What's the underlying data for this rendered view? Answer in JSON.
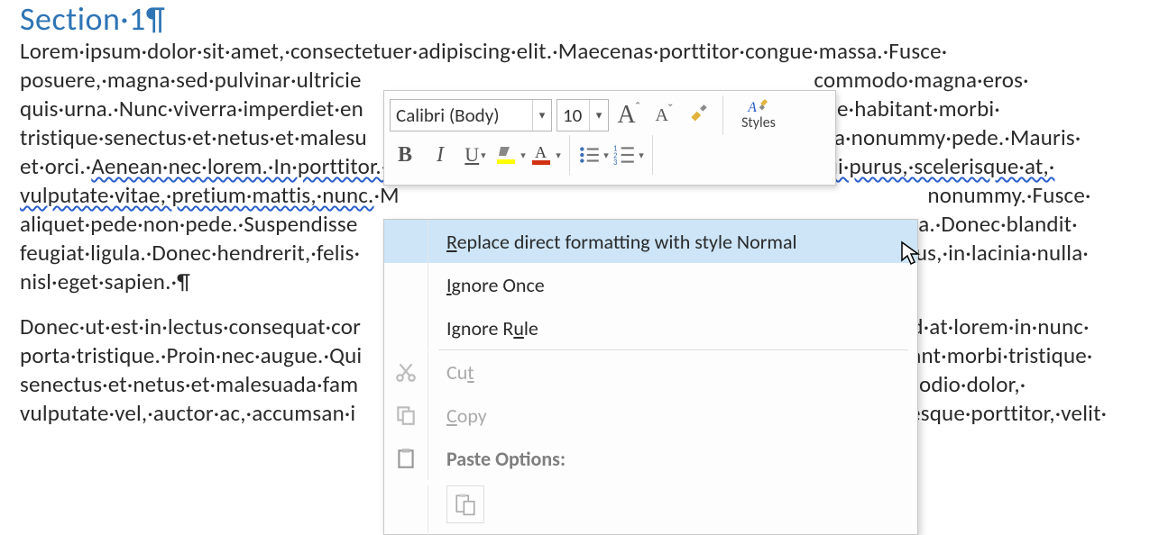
{
  "heading": "Section·1¶",
  "paragraph1": {
    "line1": "Lorem·ipsum·dolor·sit·amet,·consectetuer·adipiscing·elit.·Maecenas·porttitor·congue·massa.·Fusce·",
    "line2_left": "posuere,·magna·sed·pulvinar·ultricie",
    "line2_right": "commodo·magna·eros·",
    "line3_left": "quis·urna.·Nunc·viverra·imperdiet·en",
    "line3_right": "ue·habitant·morbi·",
    "line4_left": "tristique·senectus·et·netus·et·malesu",
    "line4_right": "ra·nonummy·pede.·Mauris·",
    "line5_pre": "et·orci.·",
    "line5_wavy": "Aenean·nec·lorem.·In·porttitor.·Donec·laoreet·nonummy·augue.·Suspendisse·dui·purus,·scelerisque·at,·",
    "line6_wavy": "vulputate·vitae,·pretium·mattis,·nunc.",
    "line6_right": "nonummy.·Fusce·",
    "line7_left": "aliquet·pede·non·pede.·Suspendisse",
    "line7_right": "a.·Donec·blandit·",
    "line8_left": "feugiat·ligula.·Donec·hendrerit,·felis·",
    "line8_right": "us,·in·lacinia·nulla·",
    "line9": "nisl·eget·sapien.·¶"
  },
  "paragraph2": {
    "line1_left": "Donec·ut·est·in·lectus·consequat·cor",
    "line1_right": "ed·at·lorem·in·nunc·",
    "line2_left": "porta·tristique.·Proin·nec·augue.·Qui",
    "line2_right": "tant·morbi·tristique·",
    "line3_left": "senectus·et·netus·et·malesuada·fam",
    "line3_right": "odio·dolor,·",
    "line4_left": "vulputate·vel,·auctor·ac,·accumsan·i",
    "line4_right": "esque·porttitor,·velit·"
  },
  "minitoolbar": {
    "font_name": "Calibri (Body)",
    "font_size": "10",
    "styles_label": "Styles"
  },
  "contextmenu": {
    "replace": "Replace direct formatting with style Normal",
    "ignore_once": "Ignore Once",
    "ignore_rule": "Ignore Rule",
    "cut": "Cut",
    "copy": "Copy",
    "paste_options": "Paste Options:"
  }
}
